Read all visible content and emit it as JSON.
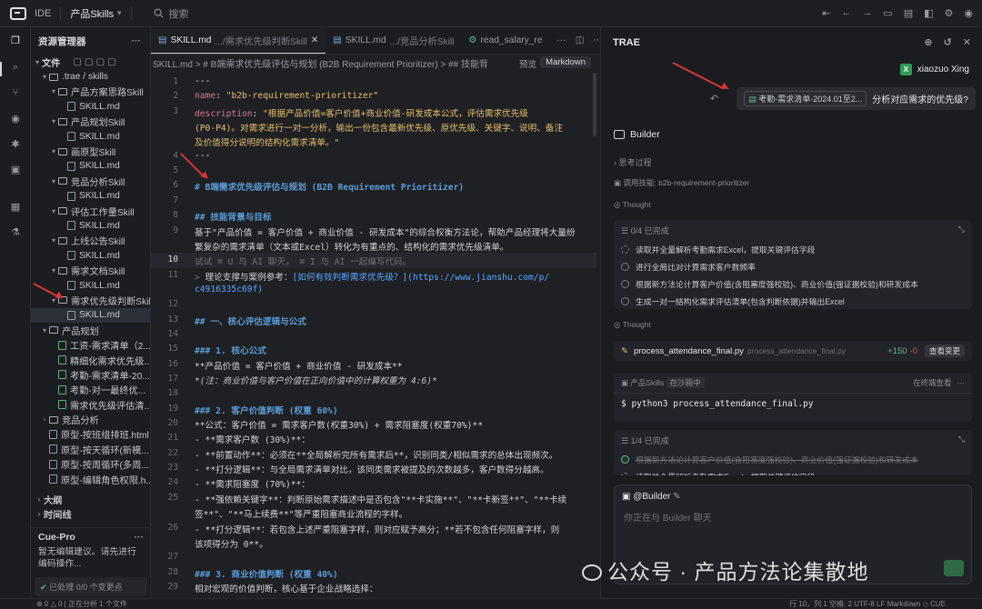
{
  "app": {
    "ide_label": "IDE",
    "project": "产品Skills",
    "search": "搜索"
  },
  "explorer": {
    "title": "资源管理器",
    "files_label": "文件",
    "tree": [
      {
        "label": ".trae / skills",
        "type": "folder",
        "indent": 0,
        "arrow": "▾"
      },
      {
        "label": "产品方案思路Skill",
        "type": "folder",
        "indent": 1,
        "arrow": "▾"
      },
      {
        "label": "SKILL.md",
        "type": "file",
        "indent": 2,
        "arrow": ""
      },
      {
        "label": "产品规划Skill",
        "type": "folder",
        "indent": 1,
        "arrow": "▾"
      },
      {
        "label": "SKILL.md",
        "type": "file",
        "indent": 2,
        "arrow": ""
      },
      {
        "label": "画原型Skill",
        "type": "folder",
        "indent": 1,
        "arrow": "▾"
      },
      {
        "label": "SKILL.md",
        "type": "file",
        "indent": 2,
        "arrow": ""
      },
      {
        "label": "竞品分析Skill",
        "type": "folder",
        "indent": 1,
        "arrow": "▾"
      },
      {
        "label": "SKILL.md",
        "type": "file",
        "indent": 2,
        "arrow": ""
      },
      {
        "label": "评估工作量Skill",
        "type": "folder",
        "indent": 1,
        "arrow": "▾"
      },
      {
        "label": "SKILL.md",
        "type": "file",
        "indent": 2,
        "arrow": ""
      },
      {
        "label": "上线公告Skill",
        "type": "folder",
        "indent": 1,
        "arrow": "▾"
      },
      {
        "label": "SKILL.md",
        "type": "file",
        "indent": 2,
        "arrow": ""
      },
      {
        "label": "需求文档Skill",
        "type": "folder",
        "indent": 1,
        "arrow": "▾"
      },
      {
        "label": "SKILL.md",
        "type": "file",
        "indent": 2,
        "arrow": ""
      },
      {
        "label": "需求优先级判断Skill",
        "type": "folder",
        "indent": 1,
        "arrow": "▾"
      },
      {
        "label": "SKILL.md",
        "type": "file",
        "indent": 2,
        "arrow": "",
        "selected": true
      },
      {
        "label": "产品规划",
        "type": "folder",
        "indent": 0,
        "arrow": "▾"
      },
      {
        "label": "工资-需求清单（2...",
        "type": "xls",
        "indent": 1,
        "arrow": ""
      },
      {
        "label": "精细化需求优先级...",
        "type": "xls",
        "indent": 1,
        "arrow": ""
      },
      {
        "label": "考勤-需求清单-20...",
        "type": "xls",
        "indent": 1,
        "arrow": ""
      },
      {
        "label": "考勤-对一最终优...",
        "type": "xls",
        "indent": 1,
        "arrow": ""
      },
      {
        "label": "需求优先级评估清...",
        "type": "xls",
        "indent": 1,
        "arrow": ""
      },
      {
        "label": "竞品分析",
        "type": "folder",
        "indent": 0,
        "arrow": "›"
      },
      {
        "label": "原型-按班组排班.html",
        "type": "file",
        "indent": 0,
        "arrow": ""
      },
      {
        "label": "原型-按天循环(新模...",
        "type": "file",
        "indent": 0,
        "arrow": ""
      },
      {
        "label": "原型-按周循环(多周...",
        "type": "file",
        "indent": 0,
        "arrow": ""
      },
      {
        "label": "原型-编辑角色权限.h...",
        "type": "file",
        "indent": 0,
        "arrow": ""
      }
    ],
    "sections": [
      "大纲",
      "时间线"
    ],
    "cue": {
      "title": "Cue-Pro",
      "msg": "暂无编辑建议。请先进行编码操作...",
      "status": "已处理 0/0 个变更点"
    }
  },
  "editor": {
    "tabs": [
      {
        "name": "SKILL.md",
        "path": ".../需求优先级判断Skill",
        "active": true
      },
      {
        "name": "SKILL.md",
        "path": ".../竞品分析Skill",
        "active": false
      },
      {
        "name": "read_salary_re",
        "path": "",
        "active": false
      }
    ],
    "breadcrumb": "SKILL.md > # B端需求优先级评估与规划 (B2B Requirement Prioritizer) > ## 技能背",
    "preview": "预览",
    "mode": "Markdown",
    "lines": [
      {
        "n": "1",
        "t": "---"
      },
      {
        "n": "2",
        "t": "name: \"b2b-requirement-prioritizer\""
      },
      {
        "n": "3",
        "t": "description: \"根据产品价值=客户价值+商业价值-研发成本公式，评估需求优先级"
      },
      {
        "n": "",
        "t": " (P0-P4)。对需求进行一对一分析，输出一份包含最新优先级、原优先级、关键字、说明、备注"
      },
      {
        "n": "",
        "t": "及价值得分说明的结构化需求清单。\""
      },
      {
        "n": "4",
        "t": "---"
      },
      {
        "n": "5",
        "t": ""
      },
      {
        "n": "6",
        "t": "# B端需求优先级评估与规划 (B2B Requirement Prioritizer)"
      },
      {
        "n": "7",
        "t": ""
      },
      {
        "n": "8",
        "t": "## 技能背景与目标"
      },
      {
        "n": "9",
        "t": "基于\"产品价值 = 客户价值 + 商业价值 - 研发成本\"的综合权衡方法论，帮助产品经理将大量纷"
      },
      {
        "n": "",
        "t": "繁复杂的需求清单（文本或Excel）转化为有重点的、结构化的需求优先级清单。"
      },
      {
        "n": "10",
        "t": "试试 ⌘ U 与 AI 聊天， ⌘ I 与 AI 一起编写代码。"
      },
      {
        "n": "11",
        "t": "> 理论支撑与案例参考：[如何有效判断需求优先级？](https://www.jianshu.com/p/"
      },
      {
        "n": "",
        "t": "c4916335c69f)"
      },
      {
        "n": "12",
        "t": ""
      },
      {
        "n": "13",
        "t": "## 一、核心评估逻辑与公式"
      },
      {
        "n": "14",
        "t": ""
      },
      {
        "n": "15",
        "t": "### 1. 核心公式"
      },
      {
        "n": "16",
        "t": "**产品价值 = 客户价值 + 商业价值 - 研发成本**"
      },
      {
        "n": "17",
        "t": "*(注：商业价值与客户价值在正向价值中的计算权重为 4:6)*"
      },
      {
        "n": "18",
        "t": ""
      },
      {
        "n": "19",
        "t": "### 2. 客户价值判断 (权重 60%)"
      },
      {
        "n": "20",
        "t": "**公式：客户价值 = 需求客户数(权重30%) + 需求阻塞度(权重70%)**"
      },
      {
        "n": "21",
        "t": "- **需求客户数 (30%)**："
      },
      {
        "n": "22",
        "t": "  - **前置动作**：必须在**全局解析完所有需求后**，识别同类/相似需求的总体出现频次。"
      },
      {
        "n": "23",
        "t": "  - **打分逻辑**：与全局需求清单对比，该同类需求被提及的次数越多，客户数得分越高。"
      },
      {
        "n": "24",
        "t": "- **需求阻塞度 (70%)**："
      },
      {
        "n": "25",
        "t": "  - **强依赖关键字**：判断原始需求描述中是否包含\"**卡实施**\"、\"**卡新签**\"、\"**卡续"
      },
      {
        "n": "",
        "t": "  签**\"、\"**马上续费**\"等严重阻塞商业流程的字样。"
      },
      {
        "n": "26",
        "t": "  - **打分逻辑**：若包含上述严重阻塞字样，则对应赋予高分；**若不包含任何阻塞字样，则"
      },
      {
        "n": "",
        "t": "  该项得分为 0**。"
      },
      {
        "n": "27",
        "t": ""
      },
      {
        "n": "28",
        "t": "### 3. 商业价值判断 (权重 40%)"
      },
      {
        "n": "29",
        "t": "相对宏观的价值判断，核心基于企业战略选择："
      }
    ]
  },
  "ai": {
    "title": "TRAE",
    "user": "xiaozuo Xing",
    "user_avatar": "X",
    "attach": "考勤-需求清单-2024.01至2...",
    "query": "分析对应需求的优先级?",
    "agent": "Builder",
    "thinking": "思考过程",
    "skill_call": "调用技能: b2b-requirement-prioritizer",
    "thought1": "Thought",
    "todo1": {
      "status": "0/4 已完成",
      "items": [
        "读取并全量解析考勤需求Excel，提取关键评估字段",
        "进行全局比对计算需求客户数频率",
        "根据新方法论计算客户价值(含阻塞度强校验)、商业价值(强证据校验)和研发成本",
        "生成一对一结构化需求评估清单(包含判断依据)并输出Excel"
      ]
    },
    "thought2": "Thought",
    "file": {
      "name": "process_attendance_final.py",
      "path": "process_attendance_final.py",
      "add": "+150",
      "del": "-0",
      "btn": "查看变更"
    },
    "term": {
      "proj": "产品Skills",
      "status": "在沙箱中",
      "open": "在终端查看",
      "cmd": "$ python3 process_attendance_final.py"
    },
    "todo2": {
      "status": "1/4 已完成",
      "items": [
        "根据新方法论计算客户价值(含阻塞度强校验)、商业价值(强证据校验)和研发成本",
        "读取并全量解析考勤需求Excel，提取关键评估字段"
      ]
    },
    "input": {
      "mention": "@Builder",
      "placeholder": "你正在与 Builder 聊天"
    }
  },
  "status_bar": {
    "left": "⊗ 0 △ 0 | 正在分析 1 个文件",
    "right": "行 10，列 1  空格: 2  UTF-8  LF  Markdown  ◇ CUE"
  },
  "watermark": "公众号 · 产品方法论集散地"
}
